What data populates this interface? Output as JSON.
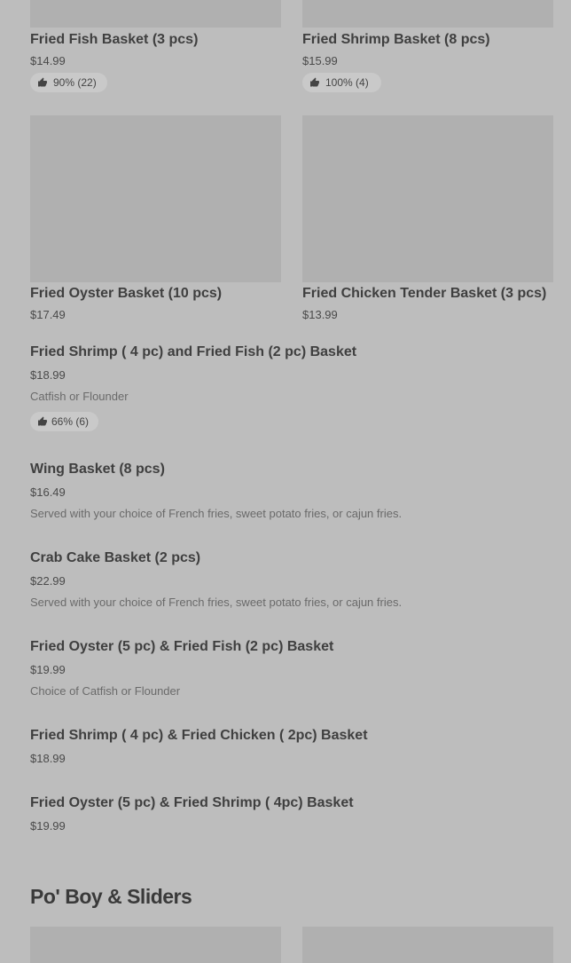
{
  "grid_items": [
    {
      "name": "Fried Fish Basket (3 pcs)",
      "price": "$14.99",
      "rating": "90% (22)"
    },
    {
      "name": "Fried Shrimp Basket (8 pcs)",
      "price": "$15.99",
      "rating": "100% (4)"
    },
    {
      "name": "Fried Oyster Basket (10 pcs)",
      "price": "$17.49"
    },
    {
      "name": "Fried Chicken Tender Basket (3 pcs)",
      "price": "$13.99"
    }
  ],
  "list_items": [
    {
      "name": "Fried Shrimp ( 4 pc) and Fried Fish (2 pc) Basket",
      "price": "$18.99",
      "description": "Catfish or Flounder",
      "rating": "66% (6)"
    },
    {
      "name": "Wing Basket (8 pcs)",
      "price": "$16.49",
      "description": "Served with your choice of French fries, sweet potato fries, or cajun fries."
    },
    {
      "name": "Crab Cake Basket (2 pcs)",
      "price": "$22.99",
      "description": "Served with your choice of French fries, sweet potato fries, or cajun fries."
    },
    {
      "name": "Fried Oyster (5 pc) & Fried Fish (2 pc) Basket",
      "price": "$19.99",
      "description": "Choice of Catfish or Flounder"
    },
    {
      "name": "Fried Shrimp ( 4 pc) & Fried Chicken ( 2pc) Basket",
      "price": "$18.99"
    },
    {
      "name": "Fried Oyster (5 pc) & Fried Shrimp ( 4pc) Basket",
      "price": "$19.99"
    }
  ],
  "section": {
    "title": "Po' Boy & Sliders"
  },
  "icons": {
    "rating": "thumbs-up-icon"
  }
}
